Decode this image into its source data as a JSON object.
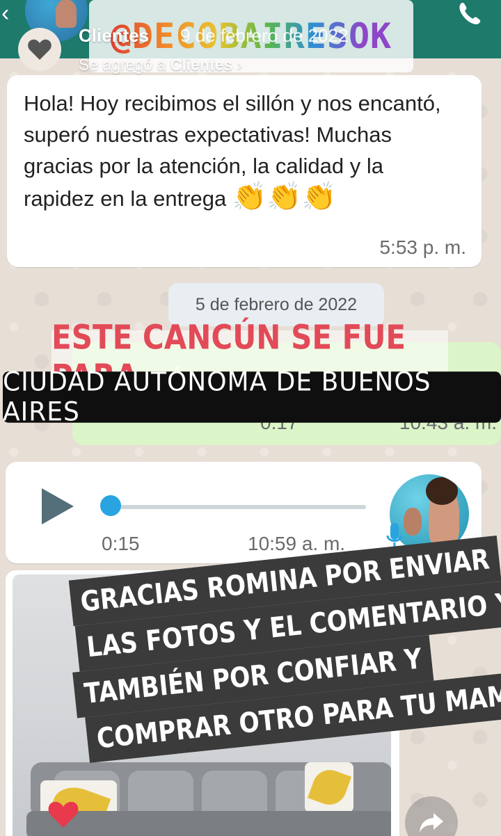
{
  "story": {
    "user": "Clientes",
    "date": "9 de febrero de 2022",
    "subtitle_prefix": "Se agregó a ",
    "subtitle_link": "Clientes",
    "subtitle_chevron": "›",
    "handle_sticker": "@DECOBAIRESOK"
  },
  "chat": {
    "message1": {
      "text": "Hola! Hoy recibimos el sillón y nos encantó, superó nuestras expectativas! Muchas gracias por la atención, la calidad y la rapidez en la entrega",
      "emoji": "👏👏👏",
      "time": "5:53 p. m."
    },
    "date_chip": "5 de febrero de 2022",
    "voice_out": {
      "duration": "0:17",
      "time": "10:43 a. m."
    },
    "voice_in": {
      "duration": "0:15",
      "time": "10:59 a. m.",
      "progress": 0.0
    }
  },
  "stickers": {
    "headline": "ESTE CANCÚN SE FUE PARA",
    "city": "CIUDAD AUTÓNOMA DE BUENOS AIRES",
    "caption_lines": [
      "GRACIAS ROMINA  POR ENVIAR",
      "LAS FOTOS Y EL COMENTARIO Y",
      "TAMBIÉN POR CONFIAR Y",
      "COMPRAR OTRO PARA TU MAMÁ"
    ]
  },
  "colors": {
    "wa_header": "#1e7a6b",
    "outgoing_bubble": "#dbf5c9",
    "headline_red": "#e24a58",
    "audio_blue": "#2aa4e0",
    "like_heart": "#e9394d"
  },
  "icons": [
    "back-arrow-icon",
    "phone-icon",
    "heart-icon",
    "play-icon",
    "mic-icon",
    "like-heart-icon",
    "share-icon"
  ]
}
